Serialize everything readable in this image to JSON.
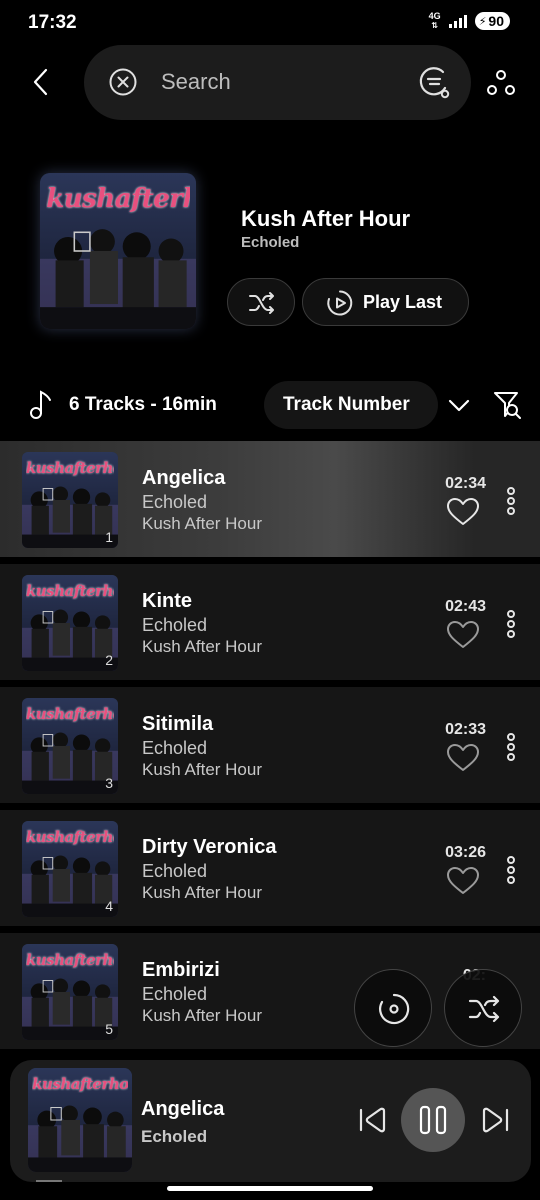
{
  "status": {
    "time": "17:32",
    "network": "4G",
    "battery": "90"
  },
  "search": {
    "placeholder": "Search"
  },
  "album": {
    "title": "Kush After Hour",
    "artist": "Echoled",
    "cover_text": "kushafterhour",
    "play_last_label": "Play Last"
  },
  "summary": {
    "tracks_label": "6 Tracks - 16min",
    "sort_label": "Track Number"
  },
  "tracks": [
    {
      "num": "1",
      "title": "Angelica",
      "artist": "Echoled",
      "album": "Kush After Hour",
      "duration": "02:34"
    },
    {
      "num": "2",
      "title": "Kinte",
      "artist": "Echoled",
      "album": "Kush After Hour",
      "duration": "02:43"
    },
    {
      "num": "3",
      "title": "Sitimila",
      "artist": "Echoled",
      "album": "Kush After Hour",
      "duration": "02:33"
    },
    {
      "num": "4",
      "title": "Dirty Veronica",
      "artist": "Echoled",
      "album": "Kush After Hour",
      "duration": "03:26"
    },
    {
      "num": "5",
      "title": "Embirizi",
      "artist": "Echoled",
      "album": "Kush After Hour",
      "duration": "02:"
    }
  ],
  "player": {
    "title": "Angelica",
    "artist": "Echoled"
  },
  "icons": {
    "back": "chevron-left-icon",
    "clear": "close-circle-icon",
    "sort": "sort-icon",
    "more": "more-dots-icon",
    "shuffle": "shuffle-icon",
    "play_last": "play-circle-icon",
    "note": "music-note-icon",
    "chevron": "chevron-down-icon",
    "filter": "filter-search-icon",
    "heart": "heart-icon",
    "kebab": "kebab-menu-icon",
    "disc": "disc-icon",
    "prev": "skip-previous-icon",
    "pause": "pause-icon",
    "next": "skip-next-icon"
  },
  "colors": {
    "background": "#000000",
    "surface": "#161616",
    "accent": "#e8507f"
  }
}
